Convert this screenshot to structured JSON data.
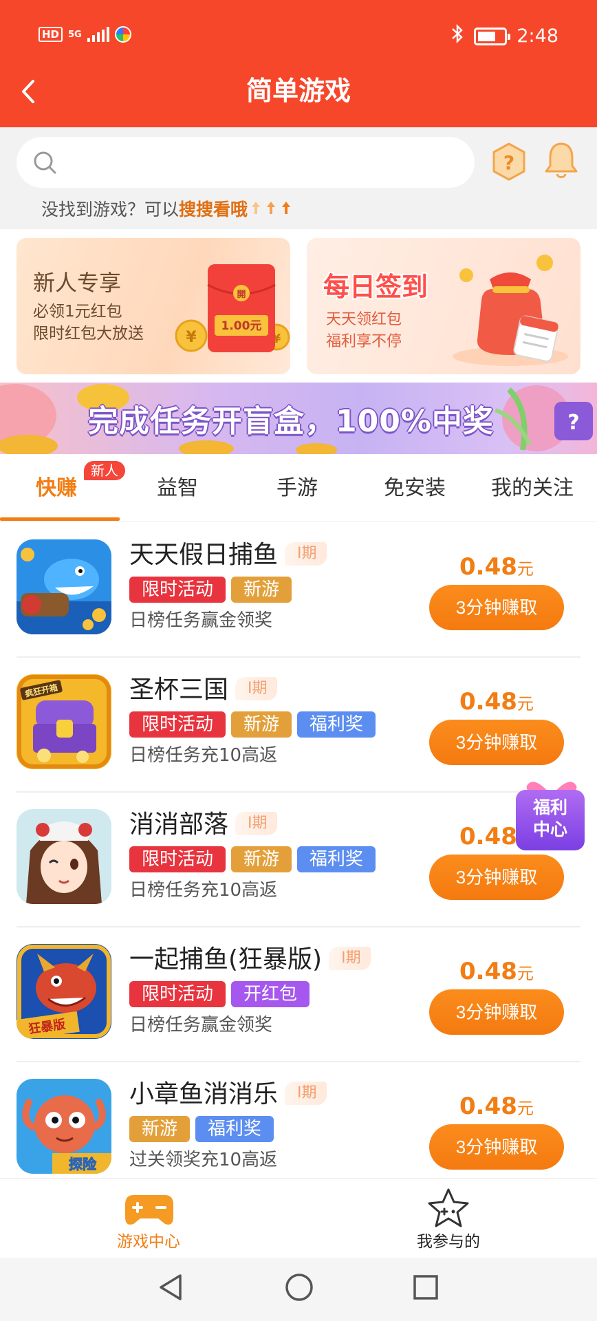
{
  "status_bar": {
    "network_badge": "HD",
    "network_type": "5G",
    "time": "2:48",
    "battery_percent": 70
  },
  "header": {
    "title": "简单游戏"
  },
  "search": {
    "placeholder": "",
    "hint_prefix": "没找到游戏？可以",
    "hint_link": "搜搜看哦"
  },
  "promos": {
    "left": {
      "title": "新人专享",
      "line1": "必领1元红包",
      "line2": "限时红包大放送",
      "packet_amount": "1.00元",
      "packet_seal": "開"
    },
    "right": {
      "title": "每日签到",
      "line1": "天天领红包",
      "line2": "福利享不停"
    }
  },
  "banner": {
    "text": "完成任务开盲盒，100%中奖"
  },
  "tabs": [
    {
      "label": "快赚",
      "badge": "新人",
      "active": true
    },
    {
      "label": "益智"
    },
    {
      "label": "手游"
    },
    {
      "label": "免安装"
    },
    {
      "label": "我的关注"
    }
  ],
  "games": [
    {
      "name": "天天假日捕鱼",
      "phase": "I期",
      "tags": [
        "限时活动",
        "新游"
      ],
      "desc": "日榜任务赢金领奖",
      "reward": "0.48",
      "unit": "元",
      "button": "3分钟赚取"
    },
    {
      "name": "圣杯三国",
      "phase": "I期",
      "tags": [
        "限时活动",
        "新游",
        "福利奖"
      ],
      "desc": "日榜任务充10高返",
      "reward": "0.48",
      "unit": "元",
      "button": "3分钟赚取",
      "icon_label": "疯狂开箱"
    },
    {
      "name": "消消部落",
      "phase": "I期",
      "tags": [
        "限时活动",
        "新游",
        "福利奖"
      ],
      "desc": "日榜任务充10高返",
      "reward": "0.48",
      "unit": "",
      "button": "3分钟赚取"
    },
    {
      "name": "一起捕鱼(狂暴版)",
      "phase": "I期",
      "tags": [
        "限时活动",
        "开红包"
      ],
      "desc": "日榜任务赢金领奖",
      "reward": "0.48",
      "unit": "元",
      "button": "3分钟赚取",
      "icon_label": "狂暴版"
    },
    {
      "name": "小章鱼消消乐",
      "phase": "I期",
      "tags": [
        "新游",
        "福利奖"
      ],
      "desc": "过关领奖充10高返",
      "reward": "0.48",
      "unit": "元",
      "button": "3分钟赚取",
      "icon_label": "探险"
    }
  ],
  "tag_colors": {
    "限时活动": "#e8343f",
    "新游": "#e3a03a",
    "福利奖": "#5b8ef0",
    "开红包": "#a557ee"
  },
  "welfare": {
    "line1": "福利",
    "line2": "中心"
  },
  "bottom_nav": [
    {
      "label": "游戏中心",
      "icon": "gamepad-icon",
      "active": true
    },
    {
      "label": "我参与的",
      "icon": "star-icon"
    }
  ],
  "colors": {
    "header": "#f7472b",
    "accent": "#f27d13"
  }
}
